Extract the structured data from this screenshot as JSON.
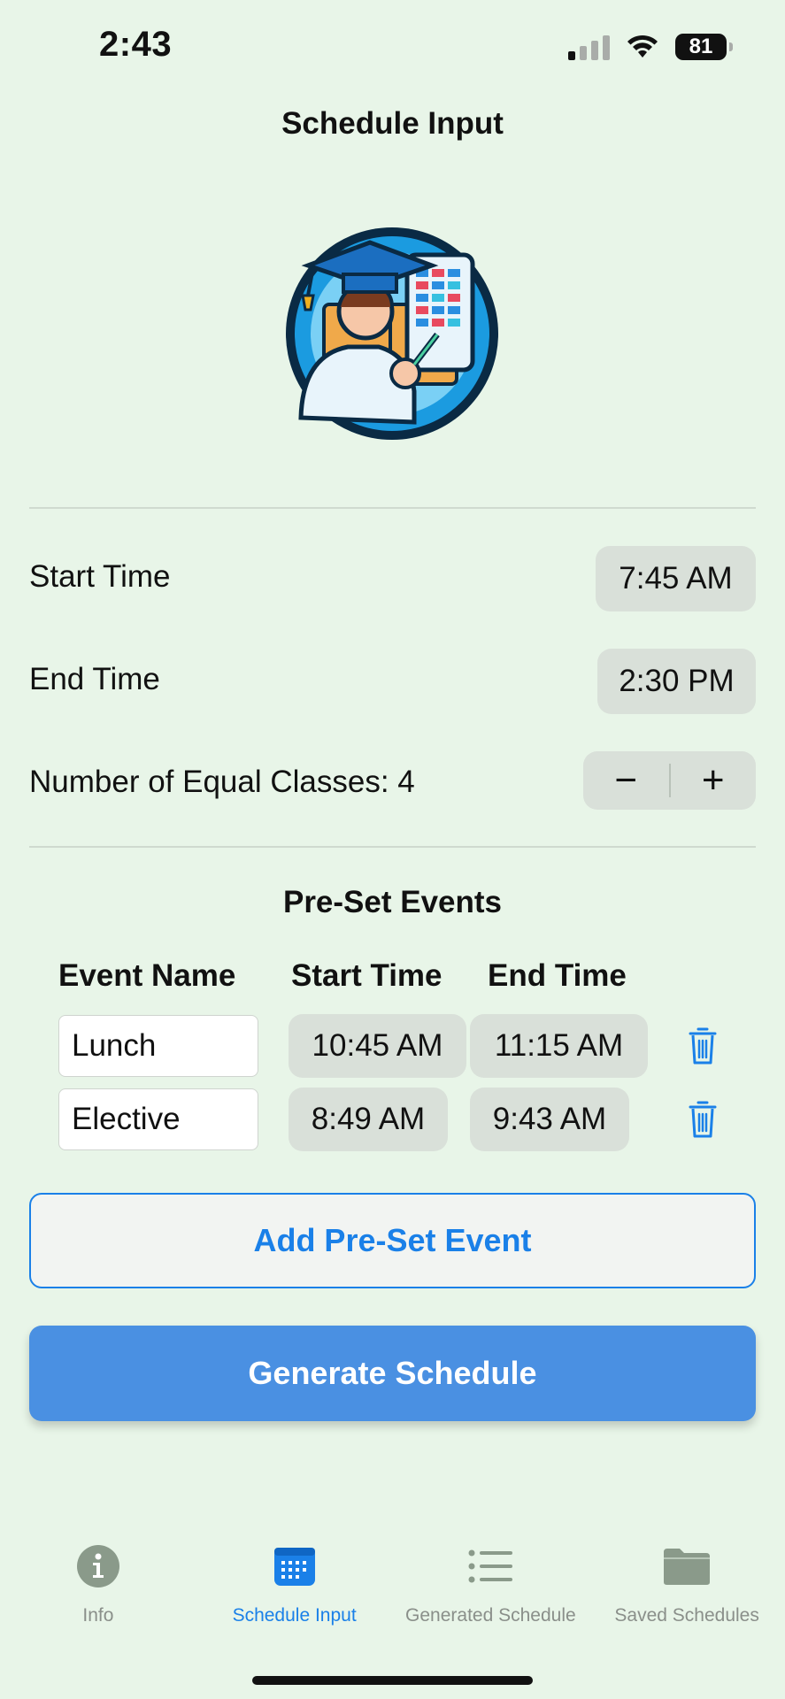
{
  "status_bar": {
    "time": "2:43",
    "battery": "81"
  },
  "title": "Schedule Input",
  "settings": {
    "start_time_label": "Start Time",
    "start_time_value": "7:45 AM",
    "end_time_label": "End Time",
    "end_time_value": "2:30 PM",
    "classes_label": "Number of Equal Classes: 4",
    "decrement_label": "−",
    "increment_label": "+"
  },
  "preset": {
    "title": "Pre-Set Events",
    "columns": [
      "Event Name",
      "Start Time",
      "End Time"
    ],
    "events": [
      {
        "name": "Lunch",
        "start": "10:45 AM",
        "end": "11:15 AM"
      },
      {
        "name": "Elective",
        "start": "8:49 AM",
        "end": "9:43 AM"
      }
    ]
  },
  "buttons": {
    "add_event": "Add Pre-Set Event",
    "generate": "Generate Schedule"
  },
  "tabs": [
    {
      "label": "Info",
      "icon": "info-icon"
    },
    {
      "label": "Schedule Input",
      "icon": "calendar-icon",
      "active": true
    },
    {
      "label": "Generated Schedule",
      "icon": "list-icon"
    },
    {
      "label": "Saved Schedules",
      "icon": "folder-icon"
    }
  ],
  "colors": {
    "background": "#e8f5e8",
    "accent": "#1a80e8",
    "primary_button": "#4a90e2",
    "pill": "#d9e0d9"
  }
}
